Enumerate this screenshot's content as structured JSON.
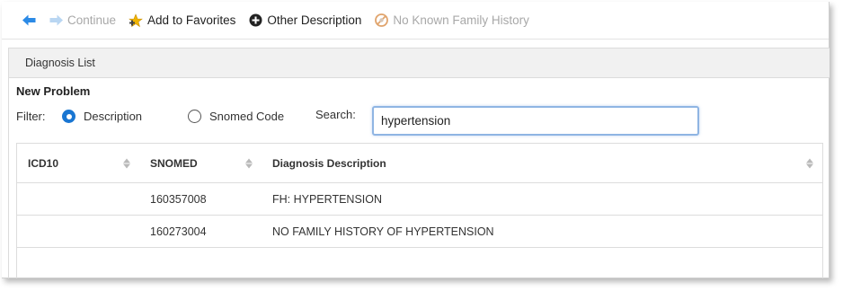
{
  "toolbar": {
    "back_icon": "arrow-left-icon",
    "continue_label": "Continue",
    "favorites_label": "Add to Favorites",
    "other_description_label": "Other Description",
    "no_family_history_label": "No Known Family History"
  },
  "panel": {
    "title": "Diagnosis List"
  },
  "form": {
    "heading": "New Problem",
    "filter_label": "Filter:",
    "filter_options": [
      "Description",
      "Snomed Code"
    ],
    "selected_filter": "Description",
    "search_label": "Search:",
    "search_value": "hypertension"
  },
  "table": {
    "columns": [
      "ICD10",
      "SNOMED",
      "Diagnosis Description"
    ],
    "rows": [
      {
        "icd10": "",
        "snomed": "160357008",
        "description": "FH: HYPERTENSION"
      },
      {
        "icd10": "",
        "snomed": "160273004",
        "description": "NO FAMILY HISTORY OF HYPERTENSION"
      }
    ]
  },
  "colors": {
    "accent": "#1976d2",
    "disabled_text": "#a8a8a8",
    "favorites_star": "#f0b400",
    "search_border": "#8fb5e3"
  }
}
